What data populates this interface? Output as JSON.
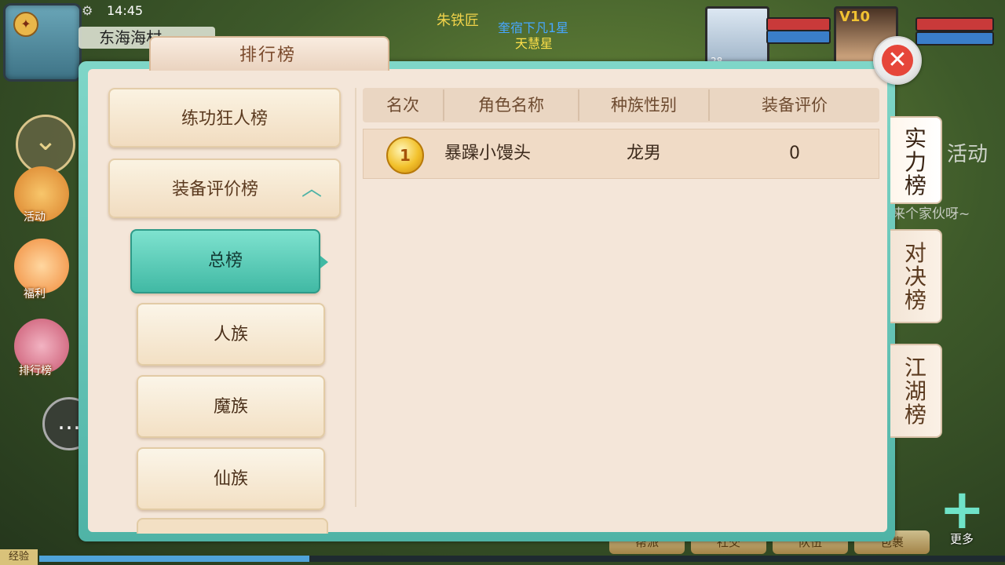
{
  "status": {
    "time": "14:45"
  },
  "location": "东海海村",
  "npc": {
    "name1": "朱铁匠",
    "name2": "奎宿下凡1星",
    "name3": "天慧星"
  },
  "party": {
    "member_level": "28",
    "vip": "V10"
  },
  "side_menu": {
    "activity": "活动",
    "welfare": "福利",
    "ranking": "排行榜"
  },
  "background_text": {
    "activity": "活动",
    "chat": "来个家伙呀~"
  },
  "bottom_bar": {
    "sect": "帮派",
    "social": "社交",
    "team": "队伍",
    "bag": "包裹",
    "more": "更多",
    "exp_label": "经验",
    "exp_progress": 0.28
  },
  "panel": {
    "title": "排行榜",
    "close_label": "✕",
    "categories": [
      {
        "label": "练功狂人榜"
      },
      {
        "label": "装备评价榜",
        "expanded": true
      }
    ],
    "subcategories": [
      "总榜",
      "人族",
      "魔族",
      "仙族"
    ],
    "active_subcategory": "总榜",
    "table": {
      "headers": [
        "名次",
        "角色名称",
        "种族性别",
        "装备评价"
      ],
      "rows": [
        {
          "rank": "1",
          "name": "暴躁小馒头",
          "race_gender": "龙男",
          "score": "0"
        }
      ]
    },
    "tabs": [
      {
        "label": "实力榜",
        "chars": [
          "实",
          "力",
          "榜"
        ],
        "active": true
      },
      {
        "label": "对决榜",
        "chars": [
          "对",
          "决",
          "榜"
        ]
      },
      {
        "label": "江湖榜",
        "chars": [
          "江",
          "湖",
          "榜"
        ]
      }
    ]
  },
  "colors": {
    "accent": "#4fb3a6",
    "panel_bg": "#f4e6d9",
    "close": "#e6463a",
    "medal": "#f2c12c"
  }
}
